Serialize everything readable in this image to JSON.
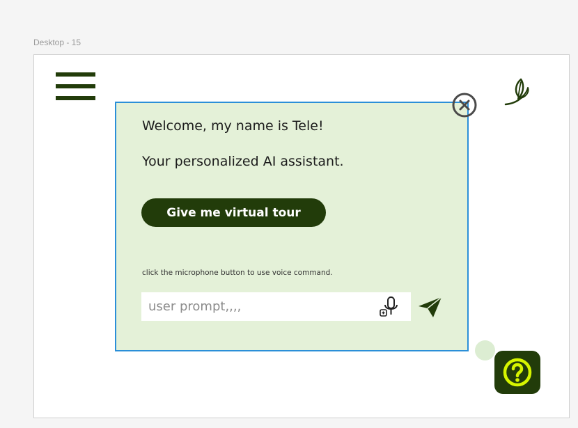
{
  "frame": {
    "label": "Desktop - 15"
  },
  "header": {
    "menu_icon": "hamburger-menu-icon",
    "logo_icon": "leaf-logo-icon",
    "close_icon": "close-circle-icon"
  },
  "assistant": {
    "welcome": "Welcome, my name is Tele!",
    "subtitle": "Your personalized AI assistant.",
    "tour_button_label": "Give me virtual tour",
    "hint": "click the microphone button to use voice command.",
    "prompt_placeholder": "user prompt,,,,",
    "mic_icon": "microphone-icon",
    "send_icon": "send-arrow-icon"
  },
  "help": {
    "icon": "question-mark-icon"
  },
  "colors": {
    "dark_green": "#223c0a",
    "dialog_background": "#e4f1d8",
    "dialog_border": "#2b8fd8",
    "help_accent": "#d6f500",
    "status_dot": "#dcedd2"
  }
}
